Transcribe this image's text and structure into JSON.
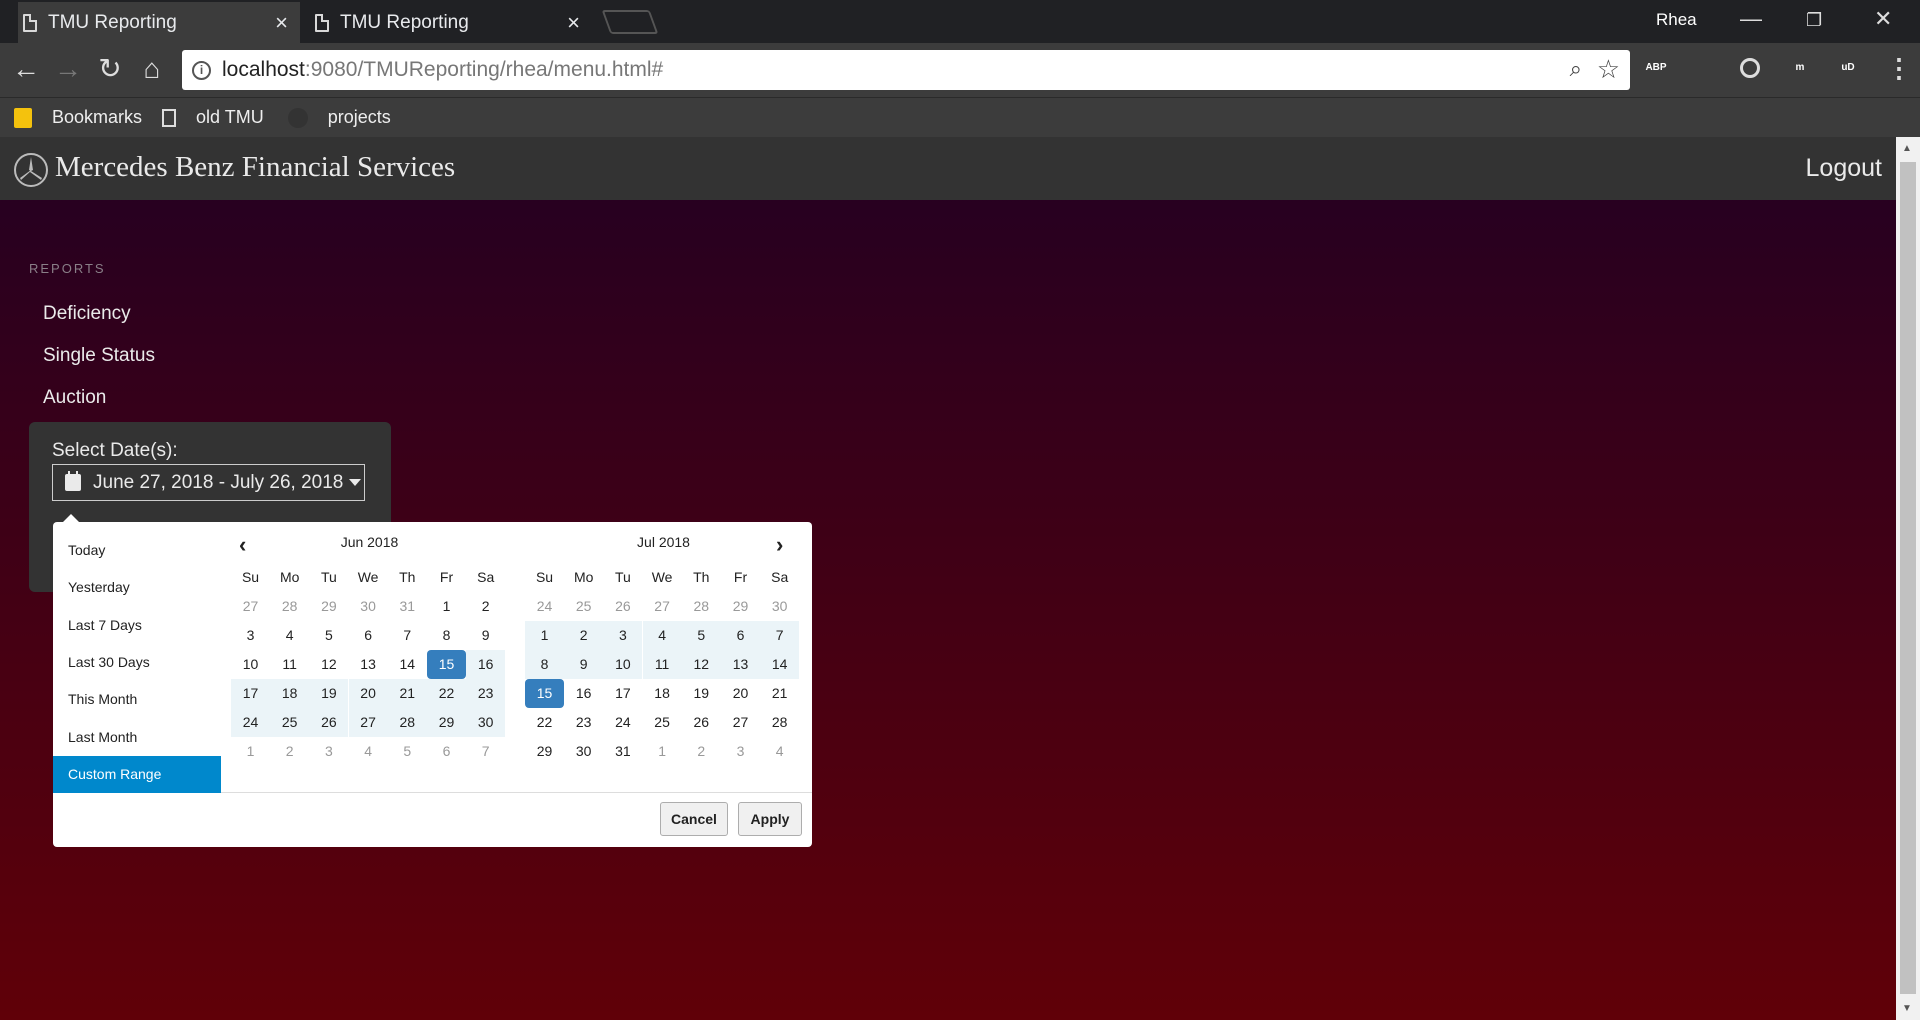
{
  "browser": {
    "tabs": [
      {
        "title": "TMU Reporting",
        "active": true
      },
      {
        "title": "TMU Reporting",
        "active": false
      }
    ],
    "profile_name": "Rhea",
    "url_host": "localhost",
    "url_rest": ":9080/TMUReporting/rhea/menu.html#",
    "extensions": [
      {
        "name": "adblock-plus-icon",
        "label": "ABP",
        "color": "#d6161e"
      },
      {
        "name": "blue-extension-icon",
        "label": "",
        "color": "#1e88e5"
      },
      {
        "name": "circle-extension-icon",
        "label": "",
        "color": "#3c3c3c"
      },
      {
        "name": "teal-extension-icon",
        "label": "m",
        "color": "#19b39b"
      },
      {
        "name": "ublock-icon",
        "label": "uD",
        "color": "#8b0000"
      }
    ],
    "bookmarks": [
      {
        "label": "Bookmarks",
        "icon": "folder-icon"
      },
      {
        "label": "old TMU",
        "icon": "page-icon"
      },
      {
        "label": "projects",
        "icon": "github-icon"
      }
    ]
  },
  "app": {
    "brand": "Mercedes Benz Financial Services",
    "logout": "Logout",
    "reports_label": "REPORTS",
    "nav": [
      "Deficiency",
      "Single Status",
      "Auction"
    ],
    "date_label": "Select Date(s):",
    "date_value": "June 27, 2018 - July 26, 2018"
  },
  "picker": {
    "ranges": [
      "Today",
      "Yesterday",
      "Last 7 Days",
      "Last 30 Days",
      "This Month",
      "Last Month",
      "Custom Range"
    ],
    "active_range": "Custom Range",
    "weekdays": [
      "Su",
      "Mo",
      "Tu",
      "We",
      "Th",
      "Fr",
      "Sa"
    ],
    "left": {
      "title": "Jun 2018",
      "weeks": [
        [
          [
            "27",
            "off"
          ],
          [
            "28",
            "off"
          ],
          [
            "29",
            "off"
          ],
          [
            "30",
            "off"
          ],
          [
            "31",
            "off"
          ],
          [
            "1",
            ""
          ],
          [
            "2",
            ""
          ]
        ],
        [
          [
            "3",
            ""
          ],
          [
            "4",
            ""
          ],
          [
            "5",
            ""
          ],
          [
            "6",
            ""
          ],
          [
            "7",
            ""
          ],
          [
            "8",
            ""
          ],
          [
            "9",
            ""
          ]
        ],
        [
          [
            "10",
            ""
          ],
          [
            "11",
            ""
          ],
          [
            "12",
            ""
          ],
          [
            "13",
            ""
          ],
          [
            "14",
            ""
          ],
          [
            "15",
            "end"
          ],
          [
            "16",
            "in"
          ]
        ],
        [
          [
            "17",
            "in"
          ],
          [
            "18",
            "in"
          ],
          [
            "19",
            "in"
          ],
          [
            "20",
            "in"
          ],
          [
            "21",
            "in"
          ],
          [
            "22",
            "in"
          ],
          [
            "23",
            "in"
          ]
        ],
        [
          [
            "24",
            "in"
          ],
          [
            "25",
            "in"
          ],
          [
            "26",
            "in"
          ],
          [
            "27",
            "in"
          ],
          [
            "28",
            "in"
          ],
          [
            "29",
            "in"
          ],
          [
            "30",
            "in"
          ]
        ],
        [
          [
            "1",
            "off"
          ],
          [
            "2",
            "off"
          ],
          [
            "3",
            "off"
          ],
          [
            "4",
            "off"
          ],
          [
            "5",
            "off"
          ],
          [
            "6",
            "off"
          ],
          [
            "7",
            "off"
          ]
        ]
      ]
    },
    "right": {
      "title": "Jul 2018",
      "weeks": [
        [
          [
            "24",
            "off"
          ],
          [
            "25",
            "off"
          ],
          [
            "26",
            "off"
          ],
          [
            "27",
            "off"
          ],
          [
            "28",
            "off"
          ],
          [
            "29",
            "off"
          ],
          [
            "30",
            "off"
          ]
        ],
        [
          [
            "1",
            "in"
          ],
          [
            "2",
            "in"
          ],
          [
            "3",
            "in"
          ],
          [
            "4",
            "in"
          ],
          [
            "5",
            "in"
          ],
          [
            "6",
            "in"
          ],
          [
            "7",
            "in"
          ]
        ],
        [
          [
            "8",
            "in"
          ],
          [
            "9",
            "in"
          ],
          [
            "10",
            "in"
          ],
          [
            "11",
            "in"
          ],
          [
            "12",
            "in"
          ],
          [
            "13",
            "in"
          ],
          [
            "14",
            "in"
          ]
        ],
        [
          [
            "15",
            "end"
          ],
          [
            "16",
            ""
          ],
          [
            "17",
            ""
          ],
          [
            "18",
            ""
          ],
          [
            "19",
            ""
          ],
          [
            "20",
            ""
          ],
          [
            "21",
            ""
          ]
        ],
        [
          [
            "22",
            ""
          ],
          [
            "23",
            ""
          ],
          [
            "24",
            ""
          ],
          [
            "25",
            ""
          ],
          [
            "26",
            ""
          ],
          [
            "27",
            ""
          ],
          [
            "28",
            ""
          ]
        ],
        [
          [
            "29",
            ""
          ],
          [
            "30",
            ""
          ],
          [
            "31",
            ""
          ],
          [
            "1",
            "off"
          ],
          [
            "2",
            "off"
          ],
          [
            "3",
            "off"
          ],
          [
            "4",
            "off"
          ]
        ]
      ]
    },
    "cancel": "Cancel",
    "apply": "Apply"
  }
}
